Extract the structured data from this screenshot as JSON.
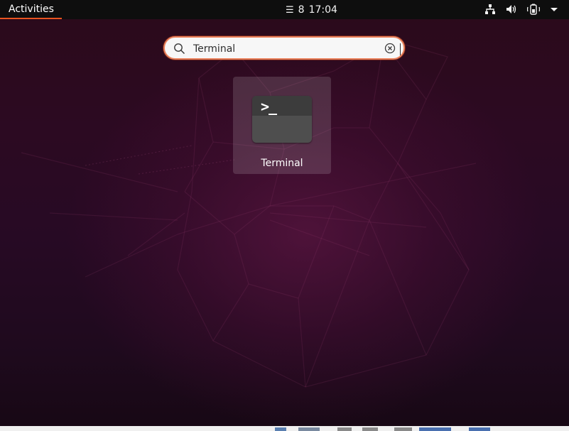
{
  "topbar": {
    "activities_label": "Activities",
    "notifications_glyph": "☰",
    "notifications_count": "8",
    "clock": "17:04",
    "tray_icons": [
      "network-icon",
      "volume-icon",
      "battery-icon",
      "system-menu-arrow-icon"
    ]
  },
  "search": {
    "value": "Terminal",
    "search_icon": "search-icon",
    "clear_icon": "clear-icon"
  },
  "results": [
    {
      "label": "Terminal",
      "icon": "terminal-icon",
      "icon_text": ">_"
    }
  ],
  "colors": {
    "accent": "#e95420",
    "topbar_bg": "#0e0e0e",
    "wallpaper_bg": "#2c0a22"
  }
}
